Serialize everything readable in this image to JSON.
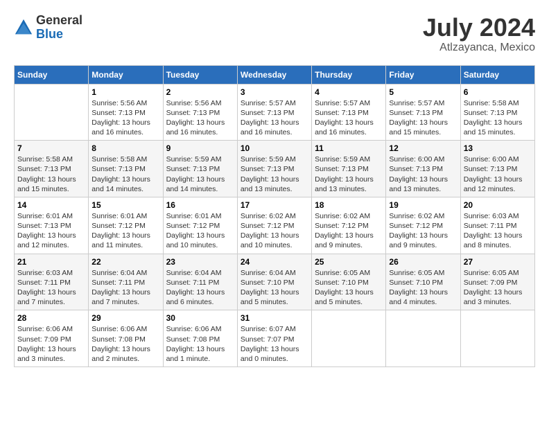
{
  "header": {
    "logo_general": "General",
    "logo_blue": "Blue",
    "month_year": "July 2024",
    "location": "Atlzayanca, Mexico"
  },
  "days_of_week": [
    "Sunday",
    "Monday",
    "Tuesday",
    "Wednesday",
    "Thursday",
    "Friday",
    "Saturday"
  ],
  "weeks": [
    [
      {
        "day": "",
        "sunrise": "",
        "sunset": "",
        "daylight": ""
      },
      {
        "day": "1",
        "sunrise": "Sunrise: 5:56 AM",
        "sunset": "Sunset: 7:13 PM",
        "daylight": "Daylight: 13 hours and 16 minutes."
      },
      {
        "day": "2",
        "sunrise": "Sunrise: 5:56 AM",
        "sunset": "Sunset: 7:13 PM",
        "daylight": "Daylight: 13 hours and 16 minutes."
      },
      {
        "day": "3",
        "sunrise": "Sunrise: 5:57 AM",
        "sunset": "Sunset: 7:13 PM",
        "daylight": "Daylight: 13 hours and 16 minutes."
      },
      {
        "day": "4",
        "sunrise": "Sunrise: 5:57 AM",
        "sunset": "Sunset: 7:13 PM",
        "daylight": "Daylight: 13 hours and 16 minutes."
      },
      {
        "day": "5",
        "sunrise": "Sunrise: 5:57 AM",
        "sunset": "Sunset: 7:13 PM",
        "daylight": "Daylight: 13 hours and 15 minutes."
      },
      {
        "day": "6",
        "sunrise": "Sunrise: 5:58 AM",
        "sunset": "Sunset: 7:13 PM",
        "daylight": "Daylight: 13 hours and 15 minutes."
      }
    ],
    [
      {
        "day": "7",
        "sunrise": "Sunrise: 5:58 AM",
        "sunset": "Sunset: 7:13 PM",
        "daylight": "Daylight: 13 hours and 15 minutes."
      },
      {
        "day": "8",
        "sunrise": "Sunrise: 5:58 AM",
        "sunset": "Sunset: 7:13 PM",
        "daylight": "Daylight: 13 hours and 14 minutes."
      },
      {
        "day": "9",
        "sunrise": "Sunrise: 5:59 AM",
        "sunset": "Sunset: 7:13 PM",
        "daylight": "Daylight: 13 hours and 14 minutes."
      },
      {
        "day": "10",
        "sunrise": "Sunrise: 5:59 AM",
        "sunset": "Sunset: 7:13 PM",
        "daylight": "Daylight: 13 hours and 13 minutes."
      },
      {
        "day": "11",
        "sunrise": "Sunrise: 5:59 AM",
        "sunset": "Sunset: 7:13 PM",
        "daylight": "Daylight: 13 hours and 13 minutes."
      },
      {
        "day": "12",
        "sunrise": "Sunrise: 6:00 AM",
        "sunset": "Sunset: 7:13 PM",
        "daylight": "Daylight: 13 hours and 13 minutes."
      },
      {
        "day": "13",
        "sunrise": "Sunrise: 6:00 AM",
        "sunset": "Sunset: 7:13 PM",
        "daylight": "Daylight: 13 hours and 12 minutes."
      }
    ],
    [
      {
        "day": "14",
        "sunrise": "Sunrise: 6:01 AM",
        "sunset": "Sunset: 7:13 PM",
        "daylight": "Daylight: 13 hours and 12 minutes."
      },
      {
        "day": "15",
        "sunrise": "Sunrise: 6:01 AM",
        "sunset": "Sunset: 7:12 PM",
        "daylight": "Daylight: 13 hours and 11 minutes."
      },
      {
        "day": "16",
        "sunrise": "Sunrise: 6:01 AM",
        "sunset": "Sunset: 7:12 PM",
        "daylight": "Daylight: 13 hours and 10 minutes."
      },
      {
        "day": "17",
        "sunrise": "Sunrise: 6:02 AM",
        "sunset": "Sunset: 7:12 PM",
        "daylight": "Daylight: 13 hours and 10 minutes."
      },
      {
        "day": "18",
        "sunrise": "Sunrise: 6:02 AM",
        "sunset": "Sunset: 7:12 PM",
        "daylight": "Daylight: 13 hours and 9 minutes."
      },
      {
        "day": "19",
        "sunrise": "Sunrise: 6:02 AM",
        "sunset": "Sunset: 7:12 PM",
        "daylight": "Daylight: 13 hours and 9 minutes."
      },
      {
        "day": "20",
        "sunrise": "Sunrise: 6:03 AM",
        "sunset": "Sunset: 7:11 PM",
        "daylight": "Daylight: 13 hours and 8 minutes."
      }
    ],
    [
      {
        "day": "21",
        "sunrise": "Sunrise: 6:03 AM",
        "sunset": "Sunset: 7:11 PM",
        "daylight": "Daylight: 13 hours and 7 minutes."
      },
      {
        "day": "22",
        "sunrise": "Sunrise: 6:04 AM",
        "sunset": "Sunset: 7:11 PM",
        "daylight": "Daylight: 13 hours and 7 minutes."
      },
      {
        "day": "23",
        "sunrise": "Sunrise: 6:04 AM",
        "sunset": "Sunset: 7:11 PM",
        "daylight": "Daylight: 13 hours and 6 minutes."
      },
      {
        "day": "24",
        "sunrise": "Sunrise: 6:04 AM",
        "sunset": "Sunset: 7:10 PM",
        "daylight": "Daylight: 13 hours and 5 minutes."
      },
      {
        "day": "25",
        "sunrise": "Sunrise: 6:05 AM",
        "sunset": "Sunset: 7:10 PM",
        "daylight": "Daylight: 13 hours and 5 minutes."
      },
      {
        "day": "26",
        "sunrise": "Sunrise: 6:05 AM",
        "sunset": "Sunset: 7:10 PM",
        "daylight": "Daylight: 13 hours and 4 minutes."
      },
      {
        "day": "27",
        "sunrise": "Sunrise: 6:05 AM",
        "sunset": "Sunset: 7:09 PM",
        "daylight": "Daylight: 13 hours and 3 minutes."
      }
    ],
    [
      {
        "day": "28",
        "sunrise": "Sunrise: 6:06 AM",
        "sunset": "Sunset: 7:09 PM",
        "daylight": "Daylight: 13 hours and 3 minutes."
      },
      {
        "day": "29",
        "sunrise": "Sunrise: 6:06 AM",
        "sunset": "Sunset: 7:08 PM",
        "daylight": "Daylight: 13 hours and 2 minutes."
      },
      {
        "day": "30",
        "sunrise": "Sunrise: 6:06 AM",
        "sunset": "Sunset: 7:08 PM",
        "daylight": "Daylight: 13 hours and 1 minute."
      },
      {
        "day": "31",
        "sunrise": "Sunrise: 6:07 AM",
        "sunset": "Sunset: 7:07 PM",
        "daylight": "Daylight: 13 hours and 0 minutes."
      },
      {
        "day": "",
        "sunrise": "",
        "sunset": "",
        "daylight": ""
      },
      {
        "day": "",
        "sunrise": "",
        "sunset": "",
        "daylight": ""
      },
      {
        "day": "",
        "sunrise": "",
        "sunset": "",
        "daylight": ""
      }
    ]
  ]
}
